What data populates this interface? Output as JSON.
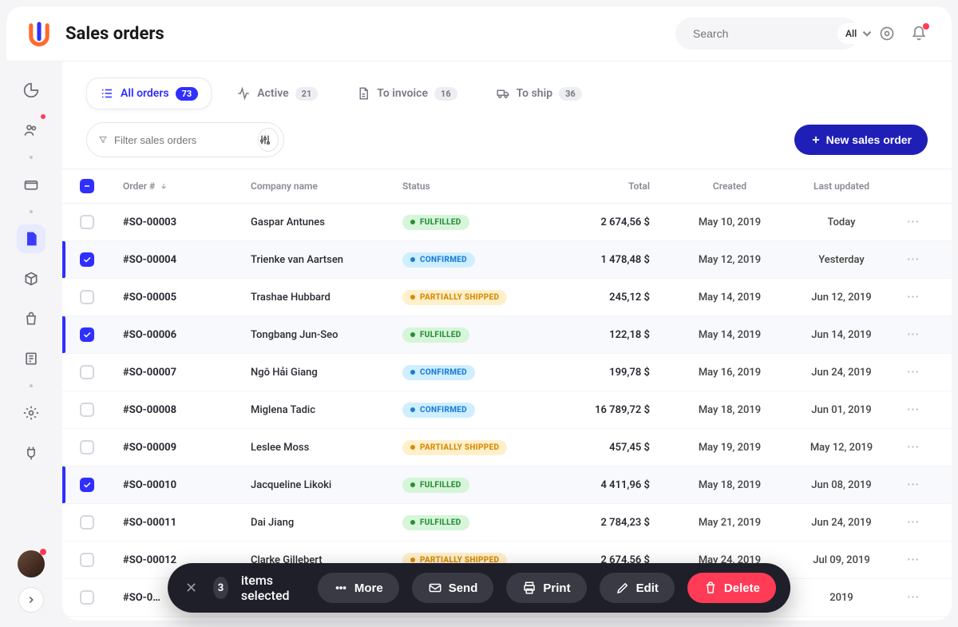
{
  "header": {
    "title": "Sales orders",
    "search_placeholder": "Search",
    "filter_label": "All"
  },
  "tabs": [
    {
      "label": "All orders",
      "count": "73",
      "active": true,
      "icon": "list"
    },
    {
      "label": "Active",
      "count": "21",
      "active": false,
      "icon": "activity"
    },
    {
      "label": "To invoice",
      "count": "16",
      "active": false,
      "icon": "file"
    },
    {
      "label": "To ship",
      "count": "36",
      "active": false,
      "icon": "truck"
    }
  ],
  "toolbar": {
    "filter_placeholder": "Filter sales orders",
    "new_button": "New sales order"
  },
  "columns": {
    "order": "Order #",
    "company": "Company name",
    "status": "Status",
    "total": "Total",
    "created": "Created",
    "updated": "Last updated"
  },
  "rows": [
    {
      "id": "#SO-00003",
      "company": "Gaspar Antunes",
      "status": "FULFILLED",
      "status_class": "st-fulfilled",
      "total": "2 674,56 $",
      "created": "May 10, 2019",
      "updated": "Today",
      "selected": false
    },
    {
      "id": "#SO-00004",
      "company": "Trienke van Aartsen",
      "status": "CONFIRMED",
      "status_class": "st-confirmed",
      "total": "1 478,48 $",
      "created": "May 12, 2019",
      "updated": "Yesterday",
      "selected": true
    },
    {
      "id": "#SO-00005",
      "company": "Trashae Hubbard",
      "status": "PARTIALLY SHIPPED",
      "status_class": "st-partial",
      "total": "245,12 $",
      "created": "May 14, 2019",
      "updated": "Jun 12, 2019",
      "selected": false
    },
    {
      "id": "#SO-00006",
      "company": "Tongbang Jun-Seo",
      "status": "FULFILLED",
      "status_class": "st-fulfilled",
      "total": "122,18 $",
      "created": "May 14, 2019",
      "updated": "Jun 14, 2019",
      "selected": true
    },
    {
      "id": "#SO-00007",
      "company": "Ngô Hải Giang",
      "status": "CONFIRMED",
      "status_class": "st-confirmed",
      "total": "199,78 $",
      "created": "May 16, 2019",
      "updated": "Jun 24, 2019",
      "selected": false
    },
    {
      "id": "#SO-00008",
      "company": "Miglena Tadic",
      "status": "CONFIRMED",
      "status_class": "st-confirmed",
      "total": "16 789,72 $",
      "created": "May 18, 2019",
      "updated": "Jun 01, 2019",
      "selected": false
    },
    {
      "id": "#SO-00009",
      "company": "Leslee Moss",
      "status": "PARTIALLY SHIPPED",
      "status_class": "st-partial",
      "total": "457,45 $",
      "created": "May 19, 2019",
      "updated": "May 12, 2019",
      "selected": false
    },
    {
      "id": "#SO-00010",
      "company": "Jacqueline Likoki",
      "status": "FULFILLED",
      "status_class": "st-fulfilled",
      "total": "4 411,96 $",
      "created": "May 18, 2019",
      "updated": "Jun 08, 2019",
      "selected": true
    },
    {
      "id": "#SO-00011",
      "company": "Dai Jiang",
      "status": "FULFILLED",
      "status_class": "st-fulfilled",
      "total": "2 784,23 $",
      "created": "May 21, 2019",
      "updated": "Jun 24, 2019",
      "selected": false
    },
    {
      "id": "#SO-00012",
      "company": "Clarke Gillebert",
      "status": "PARTIALLY SHIPPED",
      "status_class": "st-partial",
      "total": "2 674,56 $",
      "created": "May 24, 2019",
      "updated": "Jul 09, 2019",
      "selected": false
    },
    {
      "id": "#SO-0…",
      "company": "",
      "status": "",
      "status_class": "",
      "total": "",
      "created": "",
      "updated": "2019",
      "selected": false
    }
  ],
  "actionbar": {
    "count": "3",
    "text": "items selected",
    "more": "More",
    "send": "Send",
    "print": "Print",
    "edit": "Edit",
    "delete": "Delete"
  }
}
